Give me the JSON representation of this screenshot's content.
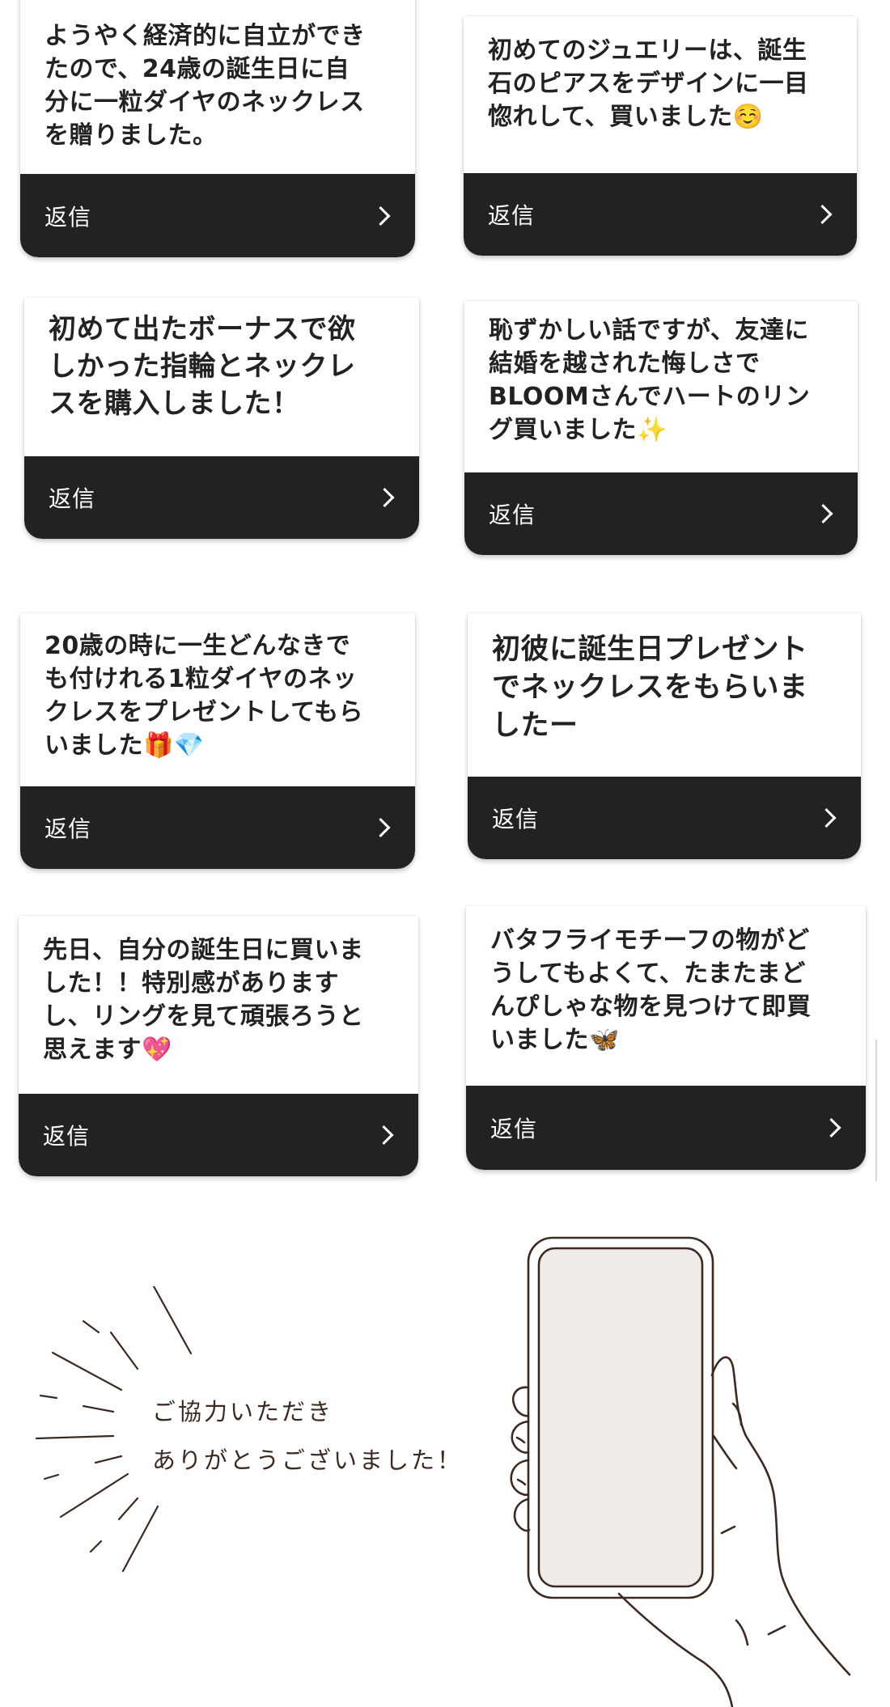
{
  "cards": [
    {
      "text": "ようやく経済的に自立ができ\nたので、24歳の誕生日に自\n分に一粒ダイヤのネックレス\nを贈りました。",
      "reply": "返信"
    },
    {
      "text": "初めてのジュエリーは、誕生\n石のピアスをデザインに一目\n惚れして、買いました☺️",
      "reply": "返信"
    },
    {
      "text": "初めて出たボーナスで欲\nしかった指輪とネックレ\nスを購入しました！",
      "reply": "返信"
    },
    {
      "text": "恥ずかしい話ですが、友達に\n結婚を越された悔しさで\nBLOOMさんでハートのリン\nグ買いました✨",
      "reply": "返信"
    },
    {
      "text": "20歳の時に一生どんなきで\nも付けれる1粒ダイヤのネッ\nクレスをプレゼントしてもら\nいました🎁💎",
      "reply": "返信"
    },
    {
      "text": "初彼に誕生日プレゼント\nでネックレスをもらいま\nしたー",
      "reply": "返信"
    },
    {
      "text": "先日、自分の誕生日に買いま\nした！！特別感があります\nし、リングを見て頑張ろうと\n思えます💖",
      "reply": "返信"
    },
    {
      "text": "バタフライモチーフの物がど\nうしてもよくて、たまたまど\nんぴしゃな物を見つけて即買\nいました🦋",
      "reply": "返信"
    }
  ],
  "thanks": {
    "line1": "ご協力いただき",
    "line2": "ありがとうございました！"
  },
  "colors": {
    "reply_bar": "#222222",
    "card_text": "#222222",
    "thanks_text": "#3b2a22",
    "phone_screen": "#efebe9"
  },
  "icons": {
    "reply_arrow": "chevron-right-icon",
    "illustration": "hand-holding-phone"
  }
}
